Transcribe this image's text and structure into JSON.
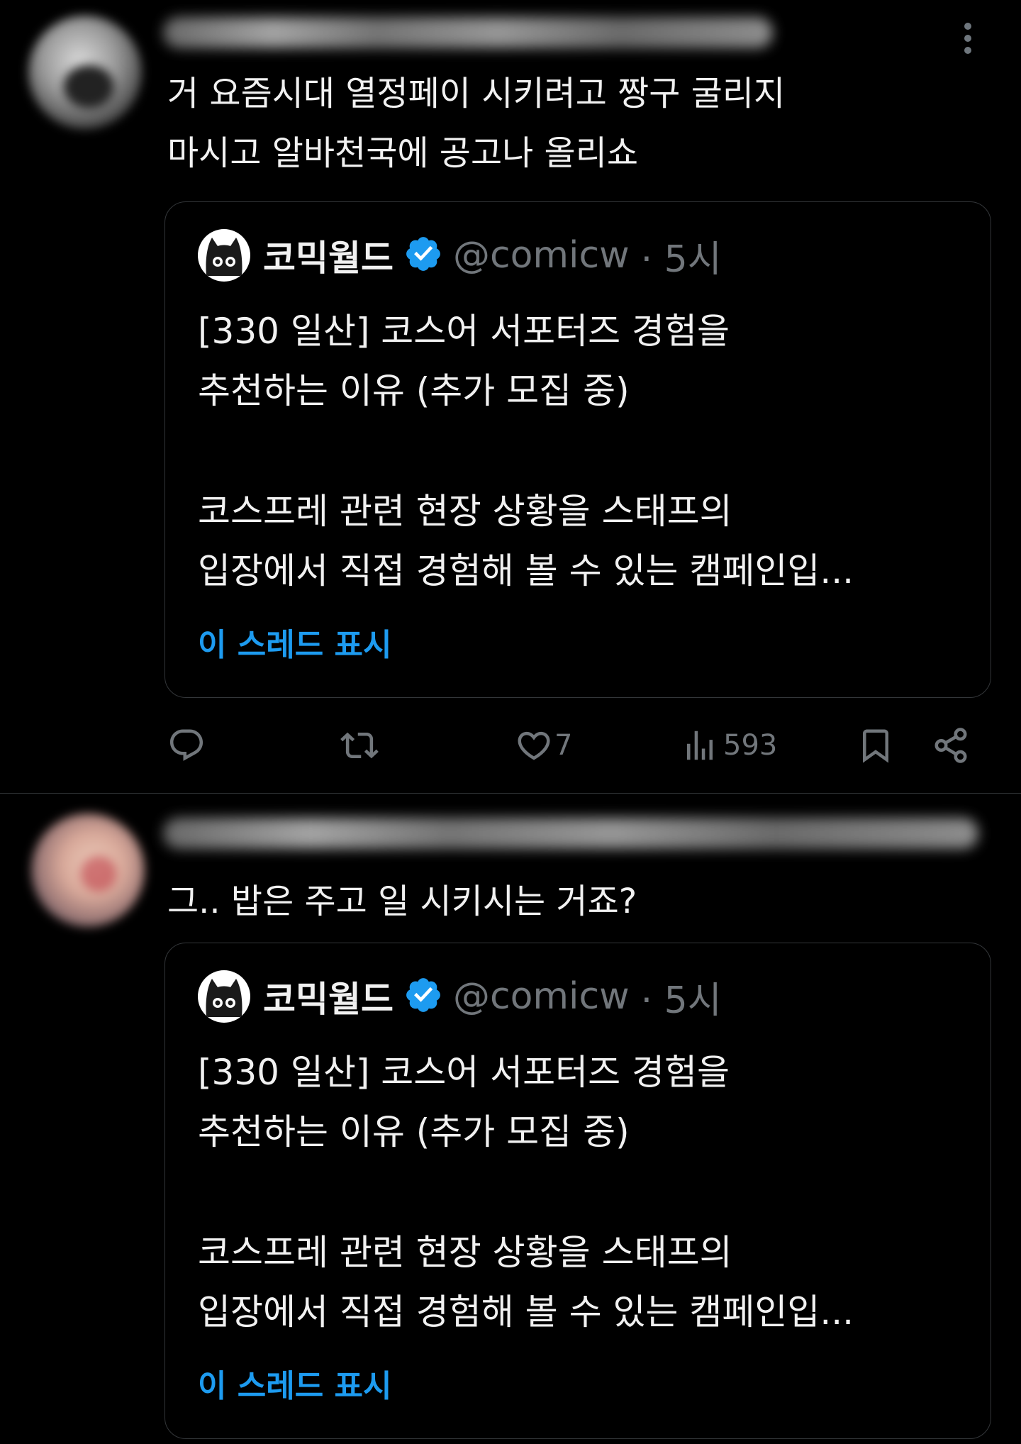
{
  "posts": [
    {
      "reply_text": "거 요즘시대 열정페이 시키려고 짱구 굴리지\n마시고 알바천국에 공고나 올리쇼",
      "quoted": {
        "name": "코믹월드",
        "handle": "@comicw",
        "time": "· 5시",
        "text_line1": "[330 일산] 코스어 서포터즈 경험을\n추천하는 이유 (추가 모집 중)",
        "text_line2": "코스프레 관련 현장 상황을 스태프의\n입장에서 직접 경험해 볼 수 있는 캠페인입...",
        "show_thread": "이 스레드 표시"
      },
      "actions": {
        "likes": "7",
        "views": "593"
      }
    },
    {
      "reply_text": "그.. 밥은 주고 일 시키시는 거죠?",
      "quoted": {
        "name": "코믹월드",
        "handle": "@comicw",
        "time": "· 5시",
        "text_line1": "[330 일산] 코스어 서포터즈 경험을\n추천하는 이유 (추가 모집 중)",
        "text_line2": "코스프레 관련 현장 상황을 스태프의\n입장에서 직접 경험해 볼 수 있는 캠페인입...",
        "show_thread": "이 스레드 표시"
      }
    }
  ],
  "colors": {
    "background": "#000000",
    "text": "#e7e9ea",
    "secondary": "#71767b",
    "link": "#1d9bf0",
    "verified": "#1d9bf0",
    "border": "#333639"
  },
  "icons": [
    "reply-icon",
    "retweet-icon",
    "like-icon",
    "views-icon",
    "bookmark-icon",
    "share-icon",
    "verified-badge-icon",
    "more-options-icon"
  ]
}
